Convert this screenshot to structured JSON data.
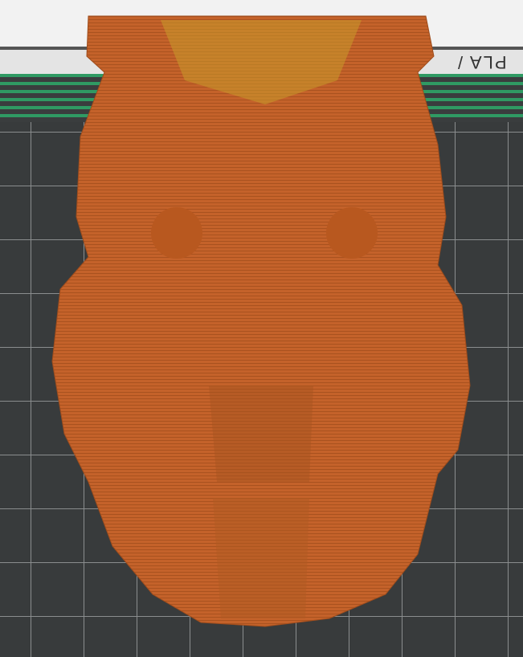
{
  "bed": {
    "label": "PLA /"
  },
  "colors": {
    "model": "#c4622a",
    "bed": "#383b3c",
    "stripes": "#2f9a63"
  }
}
